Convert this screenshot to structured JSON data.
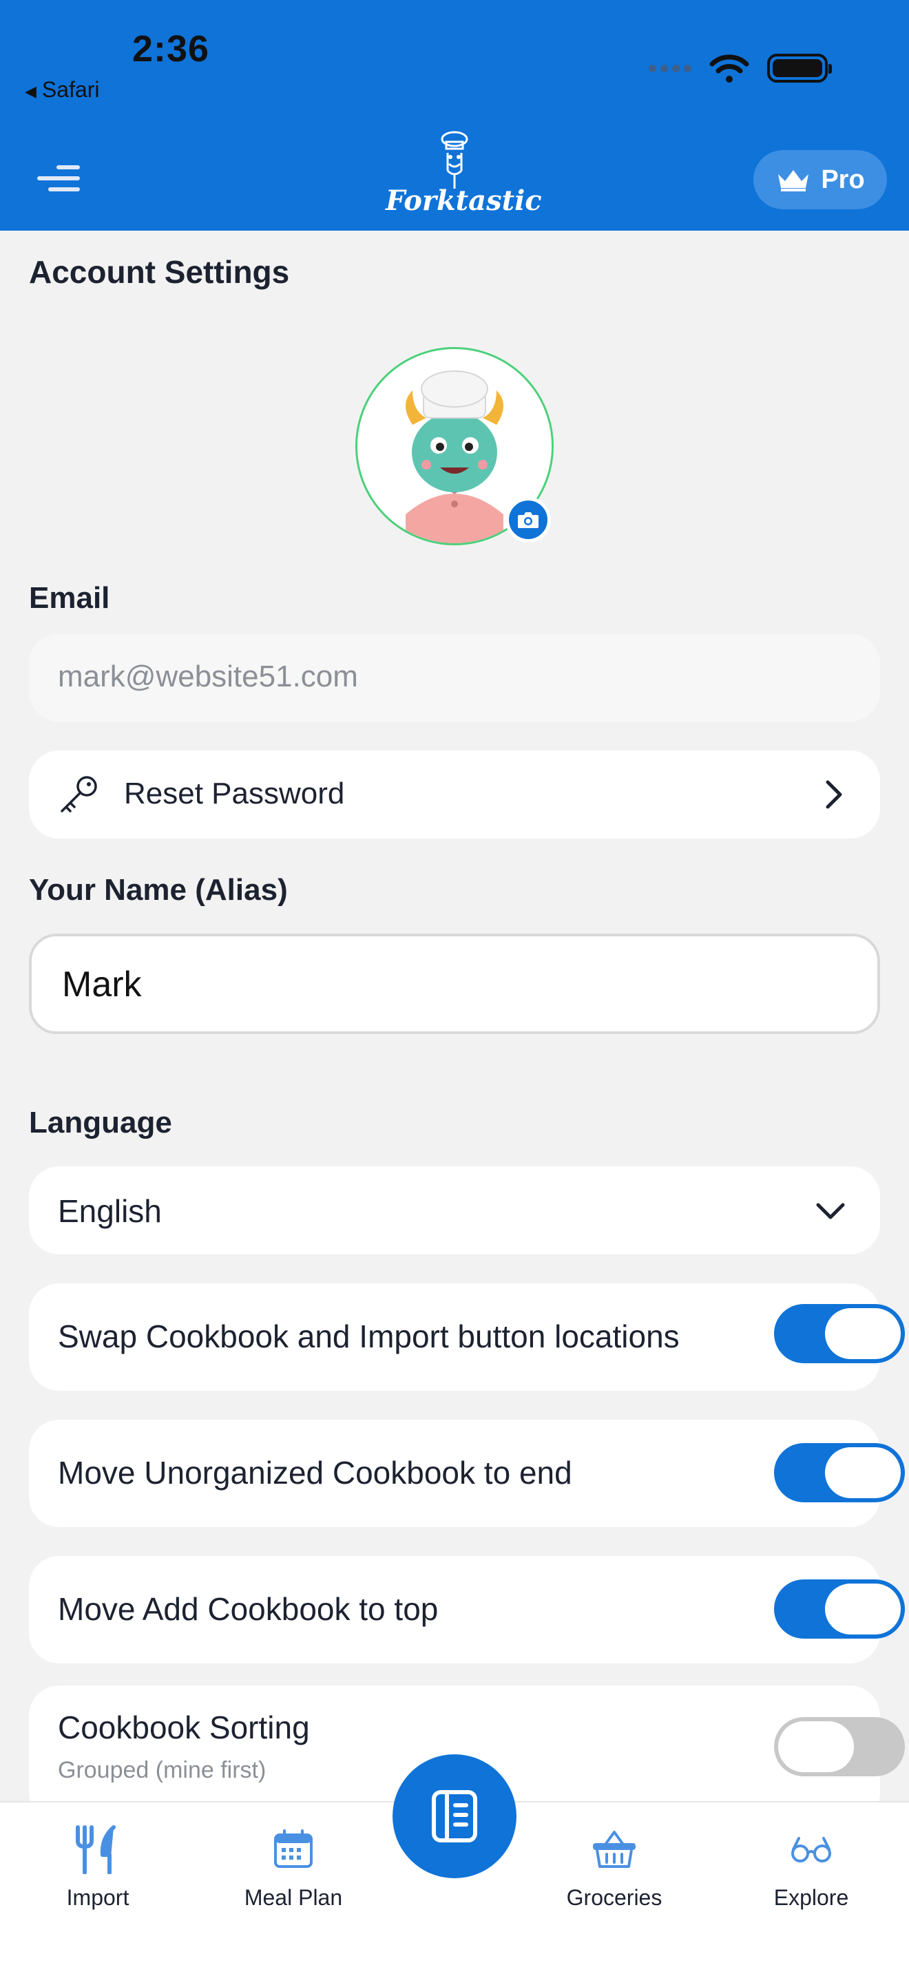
{
  "status_bar": {
    "time": "2:36",
    "back_app": "Safari"
  },
  "header": {
    "logo_text": "Forktastic",
    "pro_label": "Pro",
    "brand_color": "#0f73d8"
  },
  "page": {
    "title": "Account Settings"
  },
  "email": {
    "label": "Email",
    "value": "mark@website51.com"
  },
  "reset_password": {
    "label": "Reset Password"
  },
  "name": {
    "label": "Your Name (Alias)",
    "value": "Mark"
  },
  "language": {
    "label": "Language",
    "selected": "English"
  },
  "toggles": [
    {
      "label": "Swap Cookbook and Import button locations",
      "on": true
    },
    {
      "label": "Move Unorganized Cookbook to end",
      "on": true
    },
    {
      "label": "Move Add Cookbook to top",
      "on": true
    }
  ],
  "cookbook_sorting": {
    "label": "Cookbook Sorting",
    "value": "Grouped (mine first)",
    "on": false
  },
  "bottom_nav": {
    "items": [
      {
        "label": "Import",
        "icon": "fork-knife-icon"
      },
      {
        "label": "Meal Plan",
        "icon": "calendar-icon"
      },
      {
        "label": "Groceries",
        "icon": "basket-icon"
      },
      {
        "label": "Explore",
        "icon": "glasses-icon"
      }
    ],
    "center_icon": "cookbook-icon"
  }
}
